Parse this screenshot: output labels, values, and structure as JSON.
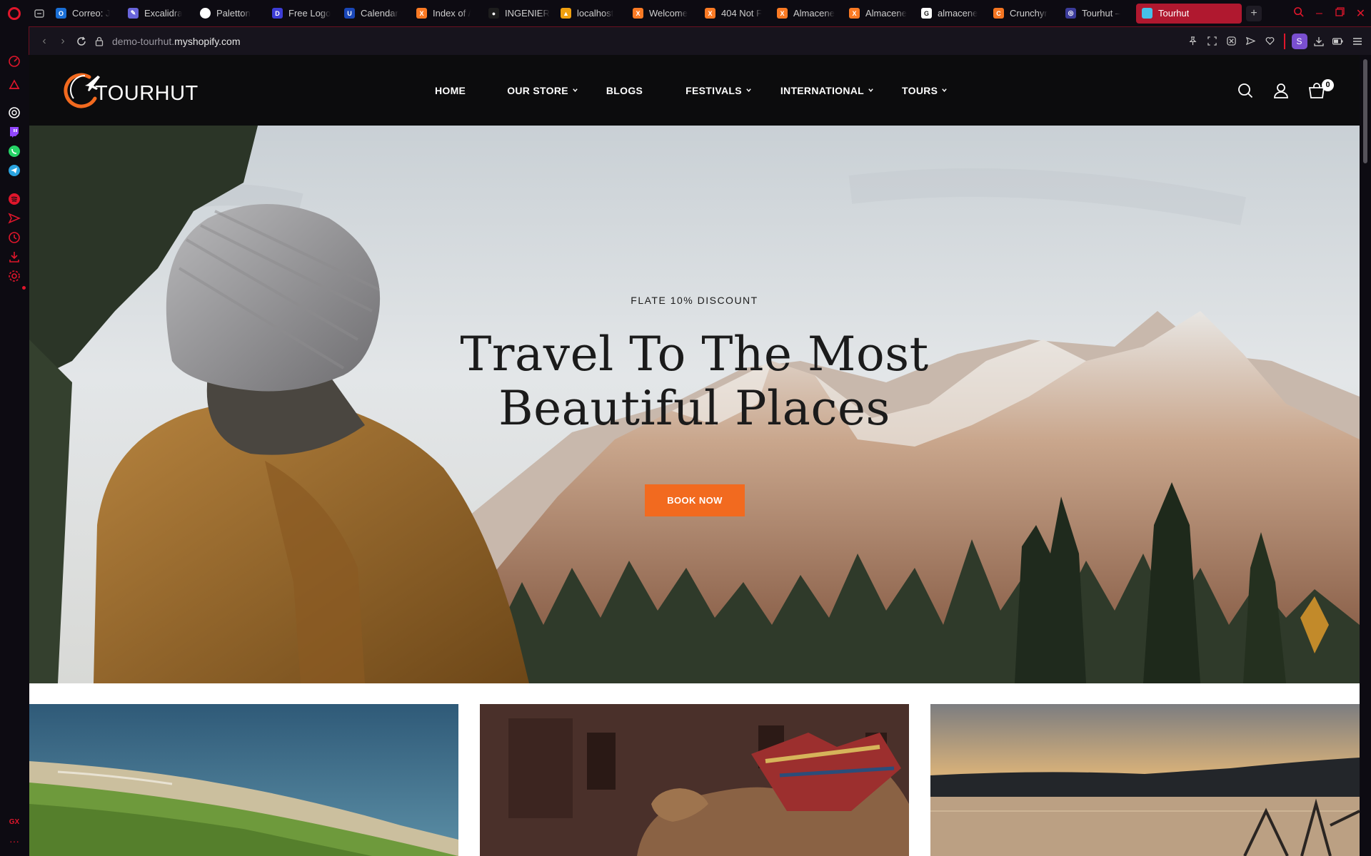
{
  "browser": {
    "tabs": [
      {
        "label": "Correo: J",
        "fav_color": "#1a6fd6",
        "fav_glyph": "O"
      },
      {
        "label": "Excalidra",
        "fav_color": "#6965db",
        "fav_glyph": "✎"
      },
      {
        "label": "Paletton",
        "fav_color": "#ffffff",
        "fav_glyph": ""
      },
      {
        "label": "Free Logo",
        "fav_color": "#3d3dd6",
        "fav_glyph": "D"
      },
      {
        "label": "Calendar",
        "fav_color": "#1a47b8",
        "fav_glyph": "U"
      },
      {
        "label": "Index of /",
        "fav_color": "#fb7a24",
        "fav_glyph": "X"
      },
      {
        "label": "INGENIER",
        "fav_color": "#1d1d1d",
        "fav_glyph": "●"
      },
      {
        "label": "localhost",
        "fav_color": "#f0a010",
        "fav_glyph": "▲"
      },
      {
        "label": "Welcome",
        "fav_color": "#fb7a24",
        "fav_glyph": "X"
      },
      {
        "label": "404 Not F",
        "fav_color": "#fb7a24",
        "fav_glyph": "X"
      },
      {
        "label": "Almacene",
        "fav_color": "#fb7a24",
        "fav_glyph": "X"
      },
      {
        "label": "Almacene",
        "fav_color": "#fb7a24",
        "fav_glyph": "X"
      },
      {
        "label": "almacene",
        "fav_color": "#ffffff",
        "fav_glyph": "G"
      },
      {
        "label": "Crunchyr",
        "fav_color": "#f47521",
        "fav_glyph": "C"
      },
      {
        "label": "Tourhut –",
        "fav_color": "#3b3b9a",
        "fav_glyph": "◎"
      }
    ],
    "active_tab": {
      "label": "Tourhut",
      "fav_color": "#46c0e8"
    },
    "url_sub": "demo-tourhut.",
    "url_domain": "myshopify.com",
    "profile_initial": "S",
    "accent": "#e0162b"
  },
  "site": {
    "brand": "TOURHUT",
    "nav": [
      {
        "label": "HOME",
        "has_dropdown": false
      },
      {
        "label": "OUR STORE",
        "has_dropdown": true
      },
      {
        "label": "BLOGS",
        "has_dropdown": false
      },
      {
        "label": "FESTIVALS",
        "has_dropdown": true
      },
      {
        "label": "INTERNATIONAL",
        "has_dropdown": true
      },
      {
        "label": "TOURS",
        "has_dropdown": true
      }
    ],
    "cart_count": "0",
    "accent": "#f26a1f"
  },
  "hero": {
    "eyebrow": "FLATE 10% DISCOUNT",
    "title_line1": "Travel To The Most",
    "title_line2": "Beautiful Places",
    "cta_label": "BOOK NOW"
  }
}
